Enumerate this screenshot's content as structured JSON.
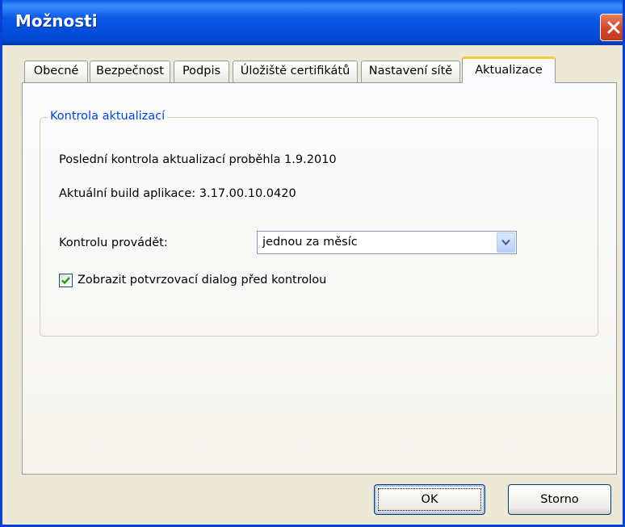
{
  "window": {
    "title": "Možnosti"
  },
  "tabs": [
    {
      "label": "Obecné",
      "active": false
    },
    {
      "label": "Bezpečnost",
      "active": false
    },
    {
      "label": "Podpis",
      "active": false
    },
    {
      "label": "Úložiště certifikátů",
      "active": false
    },
    {
      "label": "Nastavení sítě",
      "active": false
    },
    {
      "label": "Aktualizace",
      "active": true
    }
  ],
  "updates": {
    "group_title": "Kontrola aktualizací",
    "last_check_text": "Poslední kontrola aktualizací proběhla 1.9.2010",
    "build_text": "Aktuální build aplikace: 3.17.00.10.0420",
    "frequency_label": "Kontrolu provádět:",
    "frequency_value": "jednou za měsíc",
    "confirm_dialog_label": "Zobrazit potvrzovací dialog před kontrolou",
    "confirm_dialog_checked": true
  },
  "buttons": {
    "ok_label": "OK",
    "cancel_label": "Storno"
  },
  "icons": {
    "close": "close-icon",
    "dropdown": "chevron-down-icon",
    "check": "checkmark-icon"
  },
  "colors": {
    "titlebar": "#0a59e6",
    "window_border": "#0841d6",
    "dialog_bg": "#ece9d8",
    "active_tab_accent": "#ffc83c",
    "group_title": "#0046d5",
    "close_button": "#d4462a",
    "checkmark": "#21a121"
  }
}
